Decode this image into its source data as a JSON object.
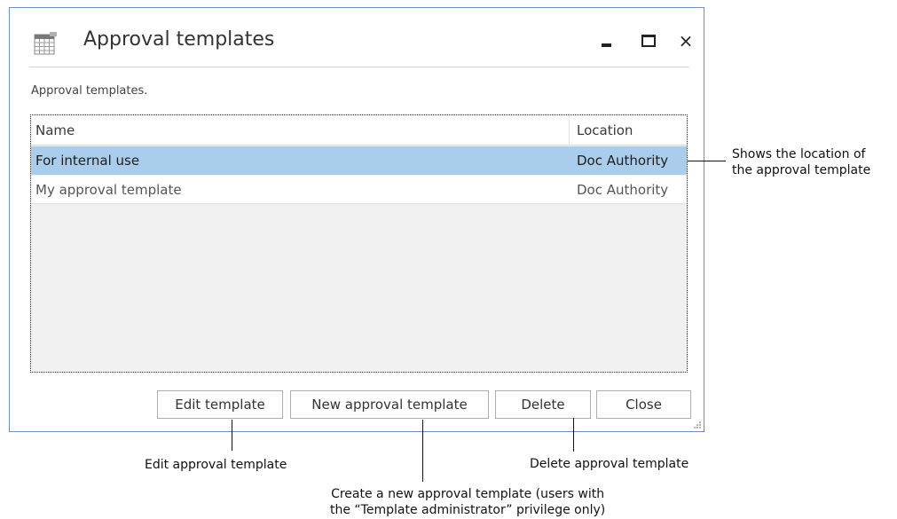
{
  "window": {
    "title": "Approval templates",
    "description": "Approval templates.",
    "controls": {
      "minimize": "minimize",
      "maximize": "maximize",
      "close": "×"
    }
  },
  "list": {
    "columns": {
      "name": "Name",
      "location": "Location"
    },
    "rows": [
      {
        "name": "For internal use",
        "location": "Doc Authority",
        "selected": true
      },
      {
        "name": "My approval template",
        "location": "Doc Authority",
        "selected": false
      }
    ]
  },
  "buttons": {
    "edit": "Edit template",
    "new": "New approval template",
    "delete": "Delete",
    "close": "Close"
  },
  "callouts": {
    "location_line1": "Shows the location of",
    "location_line2": "the approval template",
    "edit": "Edit approval template",
    "delete": "Delete approval template",
    "new_line1": "Create a new approval template (users with",
    "new_line2": "the “Template administrator” privilege only)"
  },
  "colors": {
    "selection": "#a9cdea",
    "window_border": "#6d8fc4",
    "list_bg": "#f0f0f0"
  },
  "icons": [
    "calendar-grid-icon",
    "minimize-icon",
    "maximize-icon",
    "close-icon",
    "resize-grip-icon"
  ]
}
